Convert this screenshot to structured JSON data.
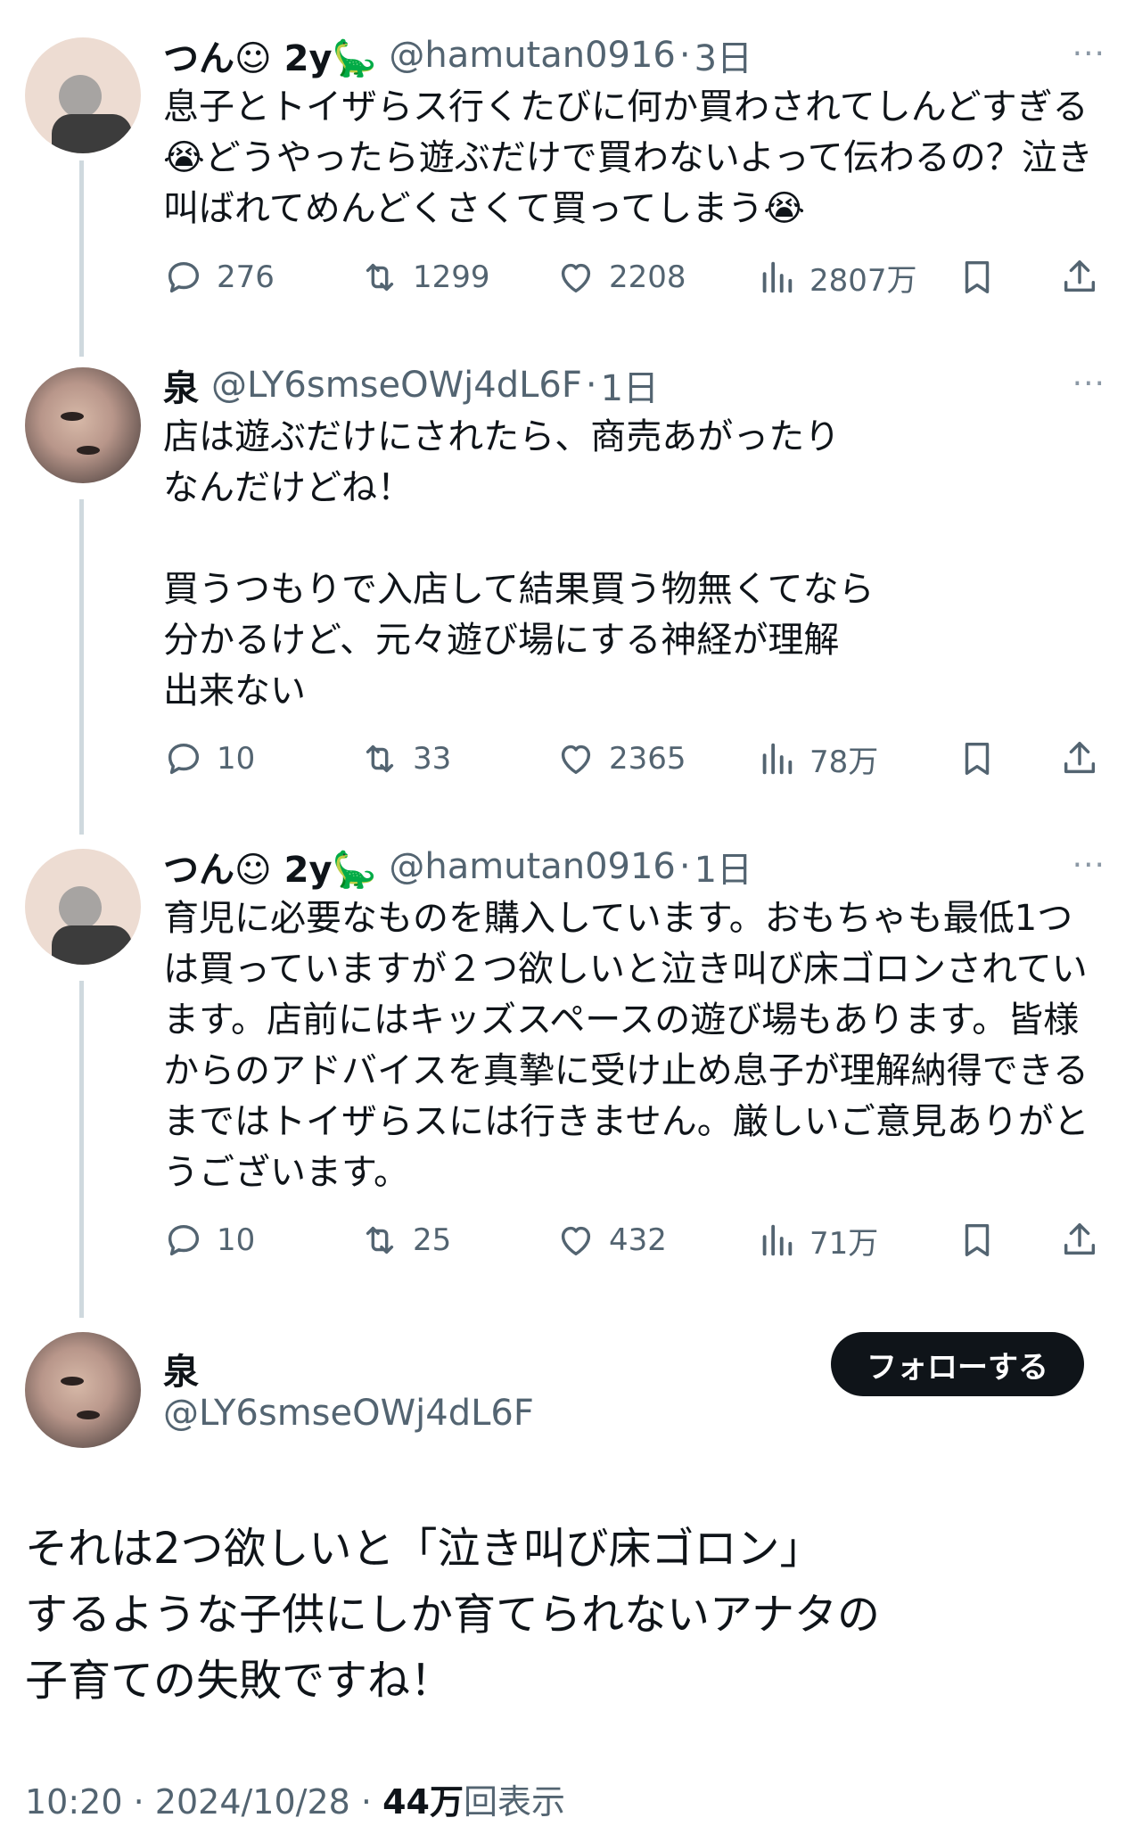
{
  "tweets": [
    {
      "name": "つん☺ 2y🦕",
      "handle": "@hamutan0916",
      "separator": "·",
      "time": "3日",
      "more": "···",
      "text": "息子とトイザらス行くたびに何か買わされてしんどすぎる😭どうやったら遊ぶだけで買わないよって伝わるの？泣き叫ばれてめんどくさくて買ってしまう😭",
      "stats": {
        "replies": "276",
        "retweets": "1299",
        "likes": "2208",
        "views": "2807万"
      }
    },
    {
      "name": "泉",
      "handle": "@LY6smseOWj4dL6F",
      "separator": "·",
      "time": "1日",
      "more": "···",
      "text": "店は遊ぶだけにされたら、商売あがったり\nなんだけどね！\n\n買うつもりで入店して結果買う物無くてなら\n分かるけど、元々遊び場にする神経が理解\n出来ない",
      "stats": {
        "replies": "10",
        "retweets": "33",
        "likes": "2365",
        "views": "78万"
      }
    },
    {
      "name": "つん☺ 2y🦕",
      "handle": "@hamutan0916",
      "separator": "·",
      "time": "1日",
      "more": "···",
      "text": "育児に必要なものを購入しています。おもちゃも最低1つは買っていますが２つ欲しいと泣き叫び床ゴロンされています。店前にはキッズスペースの遊び場もあります。皆様からのアドバイスを真摯に受け止め息子が理解納得できるまではトイザらスには行きません。厳しいご意見ありがとうございます。",
      "stats": {
        "replies": "10",
        "retweets": "25",
        "likes": "432",
        "views": "71万"
      }
    }
  ],
  "focus": {
    "name": "泉",
    "handle": "@LY6smseOWj4dL6F",
    "follow_label": "フォローする",
    "text": "それは2つ欲しいと「泣き叫び床ゴロン」\nするような子供にしか育てられないアナタの\n子育ての失敗ですね！",
    "time": "10:20",
    "sep": "·",
    "date": "2024/10/28",
    "views_count": "44万",
    "views_suffix": "回表示"
  },
  "icons": {
    "reply": "reply-icon",
    "retweet": "retweet-icon",
    "like": "heart-icon",
    "views": "views-icon",
    "bookmark": "bookmark-icon",
    "share": "share-icon"
  }
}
